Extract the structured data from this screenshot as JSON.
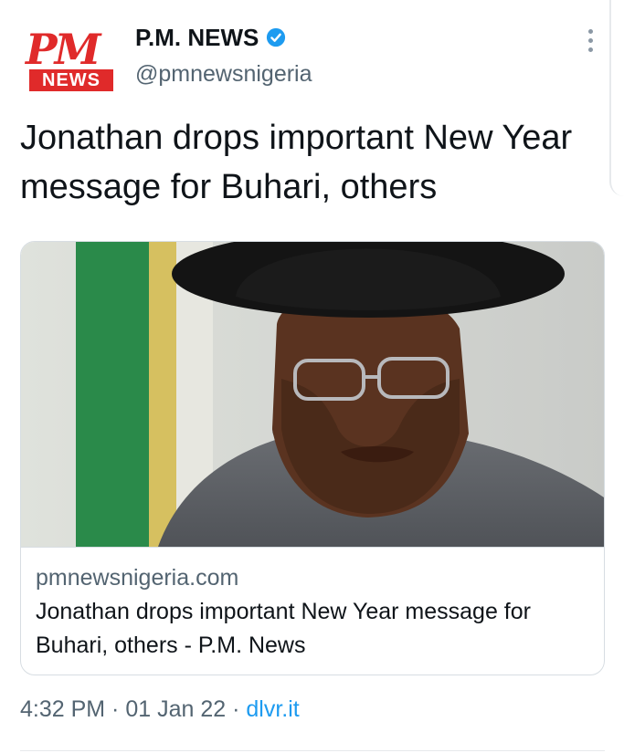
{
  "account": {
    "avatar_top": "PM",
    "avatar_bottom": "NEWS",
    "name": "P.M. NEWS",
    "handle": "@pmnewsnigeria",
    "verified": true
  },
  "tweet": {
    "text": "Jonathan drops important New Year message for Buhari, others"
  },
  "card": {
    "domain": "pmnewsnigeria.com",
    "title": "Jonathan drops important New Year message for Buhari, others - P.M. News"
  },
  "meta": {
    "time": "4:32 PM",
    "sep1": " · ",
    "date": "01 Jan 22",
    "sep2": " · ",
    "source": "dlvr.it"
  },
  "icons": {
    "verified": "verified-badge-icon",
    "more": "more-options-icon"
  },
  "colors": {
    "brand_red": "#e02a2a",
    "link_blue": "#1d9bf0",
    "verified_blue": "#1d9bf0",
    "secondary_text": "#536471"
  }
}
